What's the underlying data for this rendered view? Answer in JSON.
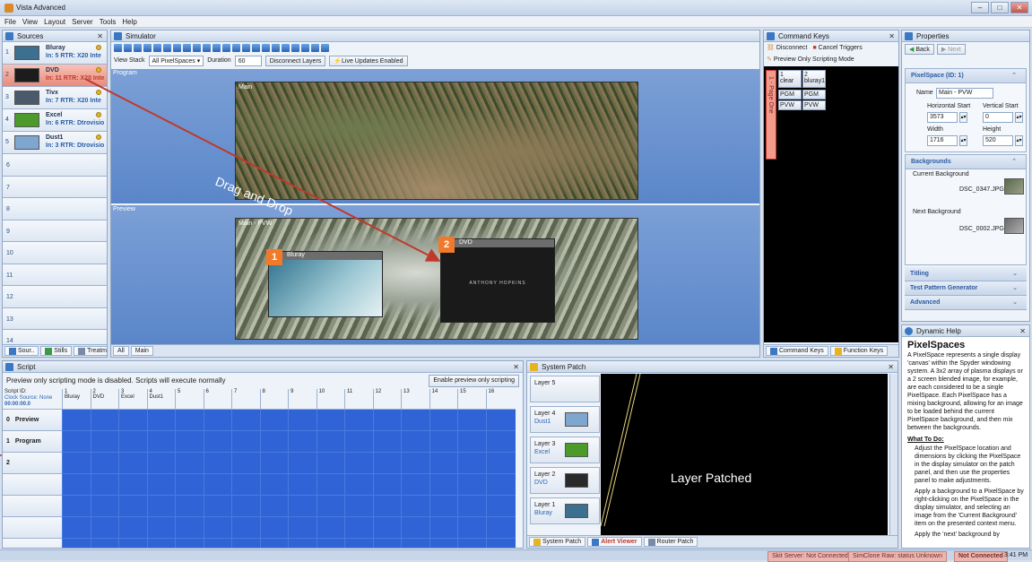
{
  "window": {
    "title": "Vista Advanced",
    "buttons": [
      "–",
      "□",
      "✕"
    ]
  },
  "menu": [
    "File",
    "View",
    "Layout",
    "Server",
    "Tools",
    "Help"
  ],
  "sources": {
    "title": "Sources",
    "items": [
      {
        "num": "1",
        "name": "Bluray",
        "info": "In: 5 RTR: X20 Inte",
        "thumb": "#3d6f8f",
        "selected": false
      },
      {
        "num": "2",
        "name": "DVD",
        "info": "In: 11 RTR: X20 Inte",
        "thumb": "#1c1c1c",
        "selected": true
      },
      {
        "num": "3",
        "name": "Tivx",
        "info": "In: 7 RTR: X20 Inte",
        "thumb": "#4a5a6a",
        "selected": false
      },
      {
        "num": "4",
        "name": "Excel",
        "info": "In: 6 RTR: Dtrovisio",
        "thumb": "#4c9a2a",
        "selected": false
      },
      {
        "num": "5",
        "name": "Dust1",
        "info": "In: 3 RTR: Dtrovisio",
        "thumb": "#7fa6cf",
        "selected": false
      }
    ],
    "empty_rows": [
      "6",
      "7",
      "8",
      "9",
      "10",
      "11",
      "12",
      "13",
      "14"
    ],
    "tabs": [
      "Sour..",
      "Stills",
      "Treatm..."
    ]
  },
  "simulator": {
    "title": "Simulator",
    "view_stack_label": "View Stack",
    "view_stack_value": "All PixelSpaces",
    "duration_label": "Duration",
    "duration_value": "60",
    "disconnect_layers": "Disconnect Layers",
    "live_updates": "Live Updates Enabled",
    "program_label": "Program",
    "preview_label": "Preview",
    "program_screen": "Main",
    "preview_screen": "Main - PVW",
    "layer1_label": "Bluray",
    "layer1_badge": "1",
    "layer2_label": "DVD",
    "layer2_badge": "2",
    "layer2_caption": "ANTHONY HOPKINS",
    "annotation": "Drag and Drop",
    "tabs": [
      "All",
      "Main"
    ]
  },
  "command_keys": {
    "title": "Command Keys",
    "disconnect": "Disconnect",
    "cancel_triggers": "Cancel Triggers",
    "preview_only": "Preview Only Scripting Mode",
    "page_tab": "1 - Page One",
    "cells": [
      {
        "id": "1",
        "name": "clear",
        "a": "PGM",
        "b": "PVW"
      },
      {
        "id": "2",
        "name": "bluray1",
        "a": "PGM",
        "b": "PVW"
      }
    ],
    "tabs": [
      "Command Keys",
      "Function Keys"
    ]
  },
  "properties": {
    "title": "Properties",
    "back": "Back",
    "next": "Next",
    "pixelspace_header": "PixelSpace (ID: 1)",
    "name_label": "Name",
    "name_value": "Main - PVW",
    "hstart_label": "Horizontal Start",
    "hstart_value": "3573",
    "vstart_label": "Vertical Start",
    "vstart_value": "0",
    "width_label": "Width",
    "width_value": "1716",
    "height_label": "Height",
    "height_value": "520",
    "backgrounds_header": "Backgrounds",
    "current_bg_label": "Current Background",
    "current_bg_value": "DSC_0347.JPG",
    "next_bg_label": "Next Background",
    "next_bg_value": "DSC_0002.JPG",
    "titling": "Titling",
    "test_pattern": "Test Pattern Generator",
    "advanced": "Advanced"
  },
  "dynamic_help": {
    "title": "Dynamic Help",
    "heading": "PixelSpaces",
    "body": "A PixelSpace represents a single display 'canvas' within the Spyder windowing system.  A 3x2 array of plasma displays or a 2 screen blended image, for example, are each considered to be a single PixelSpace.  Each PixelSpace has a mixing background, allowing for an image to be loaded behind the current PixelSpace background, and then mix between the backgrounds.",
    "what_to_do": "What To Do:",
    "bullets": [
      "Adjust the PixelSpace location and dimensions by clicking the PixelSpace in the display simulator on the patch panel, and then use the properties panel to make adjustments.",
      "Apply a background to a PixelSpace by right-clicking on the PixelSpace in the display simulator, and selecting an image from the 'Current Background' item on the presented context menu.",
      "Apply the 'next' background by"
    ]
  },
  "script": {
    "title": "Script",
    "notice": "Preview only scripting mode is disabled.  Scripts will execute normally",
    "enable_btn": "Enable preview only scripting",
    "script_id_label": "Script ID:",
    "clock_source": "Clock Source: None",
    "clock": "00:00:00.0",
    "columns": [
      {
        "n": "1",
        "name": "Bluray"
      },
      {
        "n": "2",
        "name": "DVD"
      },
      {
        "n": "3",
        "name": "Excel"
      },
      {
        "n": "4",
        "name": "Dust1"
      },
      {
        "n": "5",
        "name": ""
      },
      {
        "n": "6",
        "name": ""
      },
      {
        "n": "7",
        "name": ""
      },
      {
        "n": "8",
        "name": ""
      },
      {
        "n": "9",
        "name": ""
      },
      {
        "n": "10",
        "name": ""
      },
      {
        "n": "11",
        "name": ""
      },
      {
        "n": "12",
        "name": ""
      },
      {
        "n": "13",
        "name": ""
      },
      {
        "n": "14",
        "name": ""
      },
      {
        "n": "15",
        "name": ""
      },
      {
        "n": "16",
        "name": ""
      }
    ],
    "rows": [
      {
        "n": "0",
        "name": "Preview"
      },
      {
        "n": "1",
        "name": "Program"
      },
      {
        "n": "2",
        "name": ""
      }
    ]
  },
  "system_patch": {
    "title": "System Patch",
    "layers": [
      {
        "name": "Layer 5",
        "source": ""
      },
      {
        "name": "Layer 4",
        "source": "Dust1",
        "thumb": "#7fa6cf"
      },
      {
        "name": "Layer 3",
        "source": "Excel",
        "thumb": "#4c9a2a"
      },
      {
        "name": "Layer 2",
        "source": "DVD",
        "thumb": "#2a2a2a"
      },
      {
        "name": "Layer 1",
        "source": "Bluray",
        "thumb": "#3d6f8f"
      }
    ],
    "annotation": "Layer Patched",
    "tabs": [
      "System Patch",
      "Alert Viewer",
      "Router Patch"
    ]
  },
  "status": {
    "items": [
      "Skit Server: Not Connected",
      "SimClone Raw: status Unknown",
      "Not Connected"
    ],
    "time": "3:41 PM"
  },
  "colors": {
    "accent": "#f07a2a",
    "selected_source": "#e88a7a",
    "script_grid": "#2f63d6",
    "annotation_arrow": "#c0392b"
  }
}
